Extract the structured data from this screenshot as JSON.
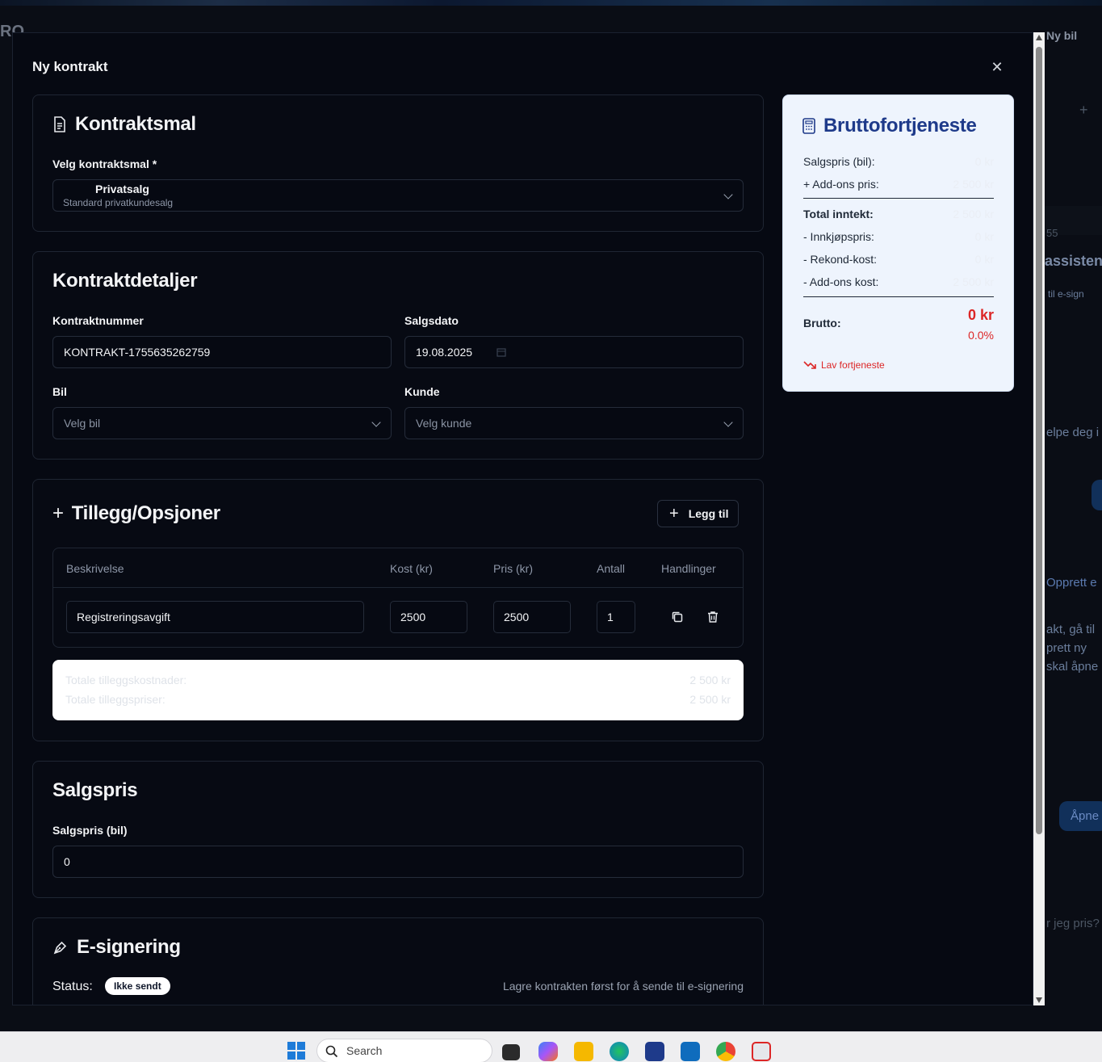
{
  "background": {
    "logo_fragment": "RO",
    "new_car_label": "Ny bil",
    "assistant_fragment": "assisten",
    "esign_fragment": "til e-sign",
    "help_fragment": "elpe deg i",
    "create_fragment": "Opprett e",
    "instruction_lines": [
      "akt, gå til",
      "prett ny",
      "skal åpne"
    ],
    "open_button": "Åpne",
    "chat_placeholder_fragment": "r jeg pris?",
    "number_fragment": "55"
  },
  "modal": {
    "title": "Ny kontrakt",
    "template_section": {
      "heading": "Kontraktsmal",
      "field_label": "Velg kontraktsmal *",
      "selected_title": "Privatsalg",
      "selected_subtitle": "Standard privatkundesalg"
    },
    "details_section": {
      "heading": "Kontraktdetaljer",
      "contract_number_label": "Kontraktnummer",
      "contract_number_value": "KONTRAKT-1755635262759",
      "sale_date_label": "Salgsdato",
      "sale_date_value": "19.08.2025",
      "car_label": "Bil",
      "car_placeholder": "Velg bil",
      "customer_label": "Kunde",
      "customer_placeholder": "Velg kunde"
    },
    "addons_section": {
      "heading": "Tillegg/Opsjoner",
      "add_button": "Legg til",
      "columns": [
        "Beskrivelse",
        "Kost (kr)",
        "Pris (kr)",
        "Antall",
        "Handlinger"
      ],
      "rows": [
        {
          "description": "Registreringsavgift",
          "cost": "2500",
          "price": "2500",
          "quantity": "1"
        }
      ],
      "total_cost_label": "Totale tilleggskostnader:",
      "total_cost_value": "2 500 kr",
      "total_price_label": "Totale tilleggspriser:",
      "total_price_value": "2 500 kr"
    },
    "price_section": {
      "heading": "Salgspris",
      "field_label": "Salgspris (bil)",
      "value": "0"
    },
    "esign_section": {
      "heading": "E-signering",
      "status_label": "Status:",
      "status_badge": "Ikke sendt",
      "hint": "Lagre kontrakten først for å sende til e-signering"
    }
  },
  "profit_panel": {
    "heading": "Bruttofortjeneste",
    "rows": [
      {
        "label": "Salgspris (bil):",
        "value": "0 kr"
      },
      {
        "label": "+ Add-ons pris:",
        "value": "2 500 kr"
      },
      {
        "label": "Total inntekt:",
        "value": "2 500 kr"
      },
      {
        "label": "- Innkjøpspris:",
        "value": "0 kr"
      },
      {
        "label": "- Rekond-kost:",
        "value": "0 kr"
      },
      {
        "label": "- Add-ons kost:",
        "value": "2 500 kr"
      }
    ],
    "brutto_label": "Brutto:",
    "brutto_value": "0 kr",
    "brutto_percent": "0.0%",
    "trend_label": "Lav fortjeneste"
  },
  "taskbar": {
    "search_placeholder": "Search"
  },
  "colors": {
    "modal_bg": "#060912",
    "panel_bg": "#eef4fd",
    "panel_heading": "#1e3a8a",
    "negative": "#dc2626",
    "accent_blue": "#1e7bd8"
  }
}
